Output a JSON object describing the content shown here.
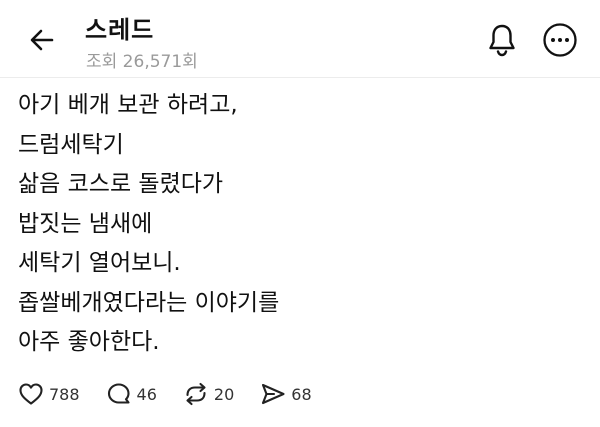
{
  "header": {
    "title": "스레드",
    "views": "조회 26,571회",
    "icons": {
      "back": "arrow-left-icon",
      "notifications": "bell-icon",
      "more": "more-circle-icon"
    }
  },
  "post": {
    "lines": [
      "아기 베개 보관 하려고,",
      "드럼세탁기",
      "삶음 코스로 돌렸다가",
      "밥짓는 냄새에",
      "세탁기 열어보니.",
      "좁쌀베개였다라는 이야기를",
      "아주 좋아한다."
    ]
  },
  "actions": {
    "likes": "788",
    "comments": "46",
    "reposts": "20",
    "shares": "68",
    "icons": {
      "likes": "heart-icon",
      "comments": "comment-icon",
      "reposts": "repost-icon",
      "shares": "share-icon"
    }
  }
}
